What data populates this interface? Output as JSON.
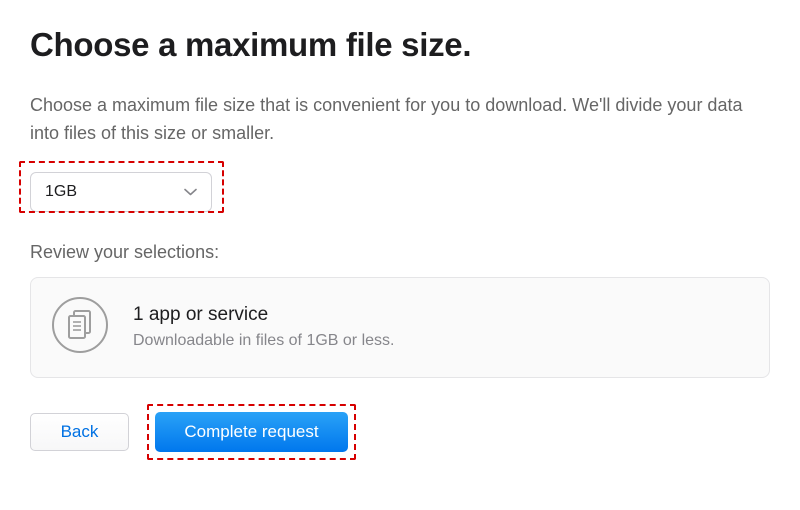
{
  "title": "Choose a maximum file size.",
  "description": "Choose a maximum file size that is convenient for you to download. We'll divide your data into files of this size or smaller.",
  "sizeSelect": {
    "value": "1GB"
  },
  "reviewLabel": "Review your selections:",
  "summary": {
    "title": "1 app or service",
    "subtitle": "Downloadable in files of 1GB or less."
  },
  "buttons": {
    "back": "Back",
    "complete": "Complete request"
  }
}
